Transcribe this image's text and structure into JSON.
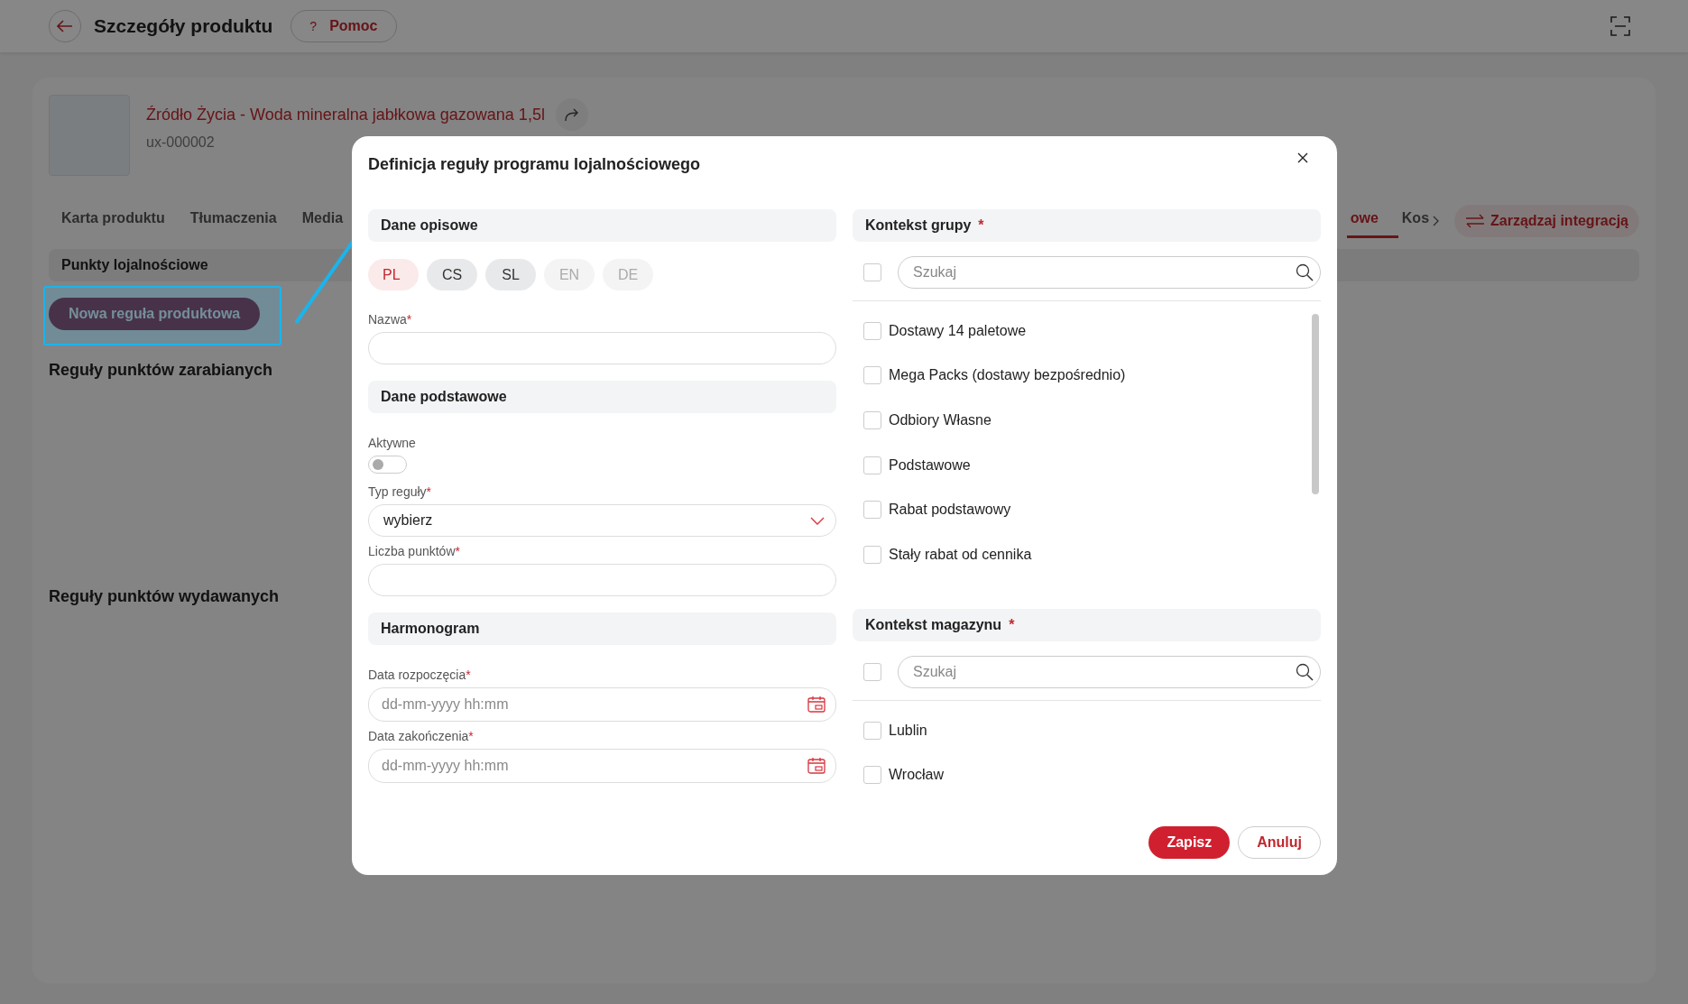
{
  "header": {
    "title": "Szczegóły produktu",
    "help_icon": "?",
    "help_label": "Pomoc"
  },
  "product": {
    "name": "Źródło Życia - Woda mineralna jabłkowa gazowana 1,5l",
    "code": "ux-000002"
  },
  "tabs": {
    "start": [
      {
        "label": "Karta produktu",
        "selected": false
      },
      {
        "label": "Tłumaczenia",
        "selected": false
      },
      {
        "label": "Media",
        "selected": false
      }
    ],
    "end": [
      {
        "label": "owe",
        "selected": true
      },
      {
        "label": "Kos",
        "selected": false
      }
    ]
  },
  "integration_button": "Zarządzaj integracją",
  "subtab": {
    "label": "Punkty lojalnościowe"
  },
  "new_rule_button": "Nowa reguła produktowa",
  "rule_sections": [
    "Reguły punktów zarabianych",
    "Reguły punktów wydawanych"
  ],
  "dialog": {
    "title": "Definicja reguły programu lojalnościowego",
    "left_sections": [
      {
        "heading": "Dane opisowe",
        "fields": [
          {
            "kind": "languages",
            "languages": [
              {
                "code": "PL",
                "selected": true,
                "disabled": false
              },
              {
                "code": "CS",
                "selected": false,
                "disabled": false
              },
              {
                "code": "SL",
                "selected": false,
                "disabled": false
              },
              {
                "code": "EN",
                "selected": false,
                "disabled": true
              },
              {
                "code": "DE",
                "selected": false,
                "disabled": true
              }
            ]
          },
          {
            "kind": "text",
            "label": "Nazwa",
            "required_mark": "*"
          }
        ]
      },
      {
        "heading": "Dane podstawowe",
        "fields": [
          {
            "kind": "toggle",
            "label": "Aktywne",
            "on": false
          },
          {
            "kind": "select",
            "label": "Typ reguły",
            "required_mark": "*",
            "value": "wybierz"
          },
          {
            "kind": "text",
            "label": "Liczba punktów",
            "required_mark": "*"
          }
        ]
      },
      {
        "heading": "Harmonogram",
        "fields": [
          {
            "kind": "datetime",
            "label": "Data rozpoczęcia",
            "required_mark": "*",
            "placeholder": "dd-mm-yyyy hh:mm"
          },
          {
            "kind": "datetime",
            "label": "Data zakończenia",
            "required_mark": "*",
            "placeholder": "dd-mm-yyyy hh:mm"
          }
        ]
      }
    ],
    "right_sections": [
      {
        "heading": "Kontekst grupy",
        "required_mark": "*",
        "select_all_checked": false,
        "search_placeholder": "Szukaj",
        "options": [
          {
            "label": "Dostawy 14 paletowe",
            "checked": false
          },
          {
            "label": "Mega Packs (dostawy bezpośrednio)",
            "checked": false
          },
          {
            "label": "Odbiory Własne",
            "checked": false
          },
          {
            "label": "Podstawowe",
            "checked": false
          },
          {
            "label": "Rabat podstawowy",
            "checked": false
          },
          {
            "label": "Stały rabat od cennika",
            "checked": false
          }
        ]
      },
      {
        "heading": "Kontekst magazynu",
        "required_mark": "*",
        "select_all_checked": false,
        "search_placeholder": "Szukaj",
        "options": [
          {
            "label": "Lublin",
            "checked": false
          },
          {
            "label": "Wrocław",
            "checked": false
          }
        ]
      }
    ],
    "actions": [
      {
        "label": "Zapisz",
        "kind": "primary"
      },
      {
        "label": "Anuluj",
        "kind": "secondary"
      }
    ]
  }
}
